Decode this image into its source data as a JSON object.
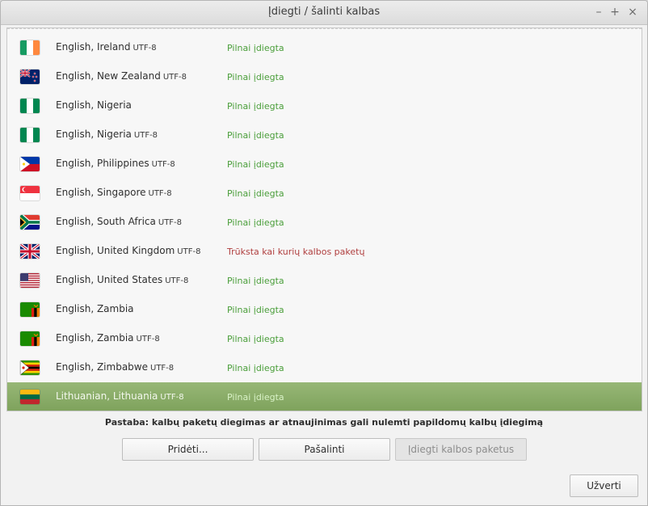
{
  "window": {
    "title": "Įdiegti / šalinti kalbas",
    "controls": {
      "minimize": "–",
      "maximize": "+",
      "close": "×"
    }
  },
  "languages": [
    {
      "name": "English, Ireland",
      "encoding": "UTF-8",
      "status": "Pilnai įdiegta",
      "status_type": "ok",
      "flag": "ireland-flag-icon"
    },
    {
      "name": "English, New Zealand",
      "encoding": "UTF-8",
      "status": "Pilnai įdiegta",
      "status_type": "ok",
      "flag": "new-zealand-flag-icon"
    },
    {
      "name": "English, Nigeria",
      "encoding": "",
      "status": "Pilnai įdiegta",
      "status_type": "ok",
      "flag": "nigeria-flag-icon"
    },
    {
      "name": "English, Nigeria",
      "encoding": "UTF-8",
      "status": "Pilnai įdiegta",
      "status_type": "ok",
      "flag": "nigeria-flag-icon"
    },
    {
      "name": "English, Philippines",
      "encoding": "UTF-8",
      "status": "Pilnai įdiegta",
      "status_type": "ok",
      "flag": "philippines-flag-icon"
    },
    {
      "name": "English, Singapore",
      "encoding": "UTF-8",
      "status": "Pilnai įdiegta",
      "status_type": "ok",
      "flag": "singapore-flag-icon"
    },
    {
      "name": "English, South Africa",
      "encoding": "UTF-8",
      "status": "Pilnai įdiegta",
      "status_type": "ok",
      "flag": "south-africa-flag-icon"
    },
    {
      "name": "English, United Kingdom",
      "encoding": "UTF-8",
      "status": "Trūksta kai kurių kalbos paketų",
      "status_type": "warn",
      "flag": "united-kingdom-flag-icon"
    },
    {
      "name": "English, United States",
      "encoding": "UTF-8",
      "status": "Pilnai įdiegta",
      "status_type": "ok",
      "flag": "united-states-flag-icon"
    },
    {
      "name": "English, Zambia",
      "encoding": "",
      "status": "Pilnai įdiegta",
      "status_type": "ok",
      "flag": "zambia-flag-icon"
    },
    {
      "name": "English, Zambia",
      "encoding": "UTF-8",
      "status": "Pilnai įdiegta",
      "status_type": "ok",
      "flag": "zambia-flag-icon"
    },
    {
      "name": "English, Zimbabwe",
      "encoding": "UTF-8",
      "status": "Pilnai įdiegta",
      "status_type": "ok",
      "flag": "zimbabwe-flag-icon"
    },
    {
      "name": "Lithuanian, Lithuania",
      "encoding": "UTF-8",
      "status": "Pilnai įdiegta",
      "status_type": "ok",
      "flag": "lithuania-flag-icon",
      "selected": true
    }
  ],
  "note": "Pastaba: kalbų paketų diegimas ar atnaujinimas gali nulemti papildomų kalbų įdiegimą",
  "buttons": {
    "add": "Pridėti...",
    "remove": "Pašalinti",
    "install_packs": "Įdiegti kalbos paketus",
    "close": "Užverti"
  },
  "colors": {
    "status_ok": "#4a9e3a",
    "status_warn": "#b03f3f",
    "selection": "#8aad67"
  }
}
